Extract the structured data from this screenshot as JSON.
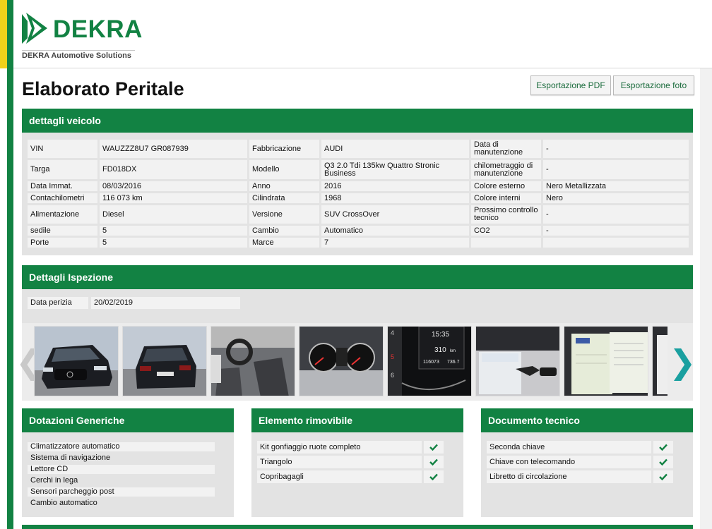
{
  "brand": {
    "name": "DEKRA",
    "subtitle": "DEKRA Automotive Solutions",
    "green": "#128243",
    "yellow": "#f0d21a"
  },
  "page": {
    "title": "Elaborato Peritale"
  },
  "toolbar": {
    "export_pdf": "Esportazione PDF",
    "export_photos": "Esportazione foto"
  },
  "vehicle": {
    "heading": "dettagli veicolo",
    "rows": [
      [
        "VIN",
        "WAUZZZ8U7 GR087939",
        "Fabbricazione",
        "AUDI",
        "Data di manutenzione",
        "-"
      ],
      [
        "Targa",
        "FD018DX",
        "Modello",
        "Q3 2.0 Tdi 135kw Quattro Stronic Business",
        "chilometraggio di manutenzione",
        "-"
      ],
      [
        "Data Immat.",
        "08/03/2016",
        "Anno",
        "2016",
        "Colore esterno",
        "Nero Metallizzata"
      ],
      [
        "Contachilometri",
        "116 073 km",
        "Cilindrata",
        "1968",
        "Colore interni",
        "Nero"
      ],
      [
        "Alimentazione",
        "Diesel",
        "Versione",
        "SUV CrossOver",
        "Prossimo controllo tecnico",
        "-"
      ],
      [
        "sedile",
        "5",
        "Cambio",
        "Automatico",
        "CO2",
        "-"
      ],
      [
        "Porte",
        "5",
        "Marce",
        "7",
        "",
        ""
      ]
    ]
  },
  "inspection": {
    "heading": "Dettagli Ispezione",
    "date_label": "Data perizia",
    "date_value": "20/02/2019"
  },
  "gallery": {
    "photos": [
      "car-front-photo",
      "car-rear-photo",
      "car-interior-photo",
      "instrument-cluster-photo",
      "odometer-photo",
      "car-keys-photo",
      "registration-document-photo",
      "document-photo"
    ],
    "odometer": {
      "clock": "15:35",
      "range": "310",
      "range_unit": "km",
      "total": "116073",
      "trip": "736.7"
    }
  },
  "equipment": {
    "heading": "Dotazioni Generiche",
    "items": [
      "Climatizzatore automatico",
      "Sistema di navigazione",
      "Lettore CD",
      "Cerchi in lega",
      "Sensori parcheggio post",
      "Cambio automatico"
    ]
  },
  "removable": {
    "heading": "Elemento rimovibile",
    "items": [
      "Kit gonfiaggio ruote completo",
      "Triangolo",
      "Copribagagli"
    ]
  },
  "tech_doc": {
    "heading": "Documento tecnico",
    "items": [
      "Seconda chiave",
      "Chiave con telecomando",
      "Libretto di circolazione"
    ]
  }
}
